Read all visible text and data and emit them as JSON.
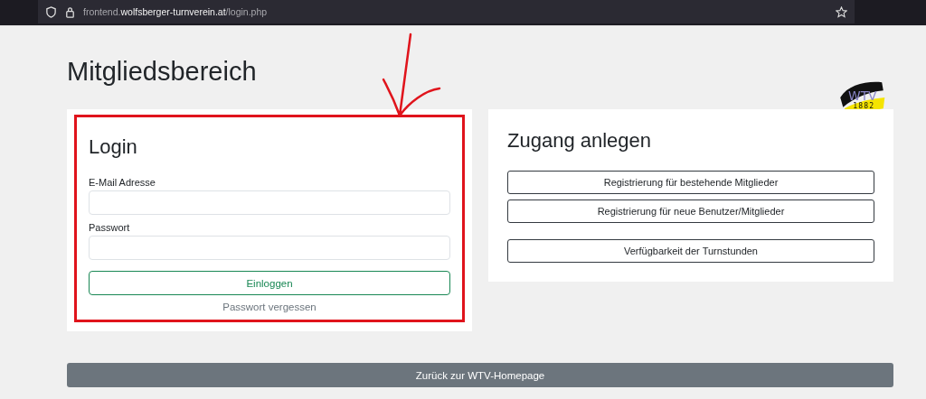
{
  "browser": {
    "url": {
      "subdomain": "frontend.",
      "domain": "wolfsberger-turnverein.at",
      "path": "/login.php"
    }
  },
  "page": {
    "title": "Mitgliedsbereich",
    "logo": {
      "letters": "WTV",
      "year": "1882"
    }
  },
  "login": {
    "title": "Login",
    "highlighted": true,
    "fields": [
      {
        "label": "E-Mail Adresse"
      },
      {
        "label": "Passwort"
      }
    ],
    "submit": "Einloggen",
    "forgot_link": "Passwort vergessen"
  },
  "register": {
    "title": "Zugang anlegen",
    "button_groups": [
      [
        "Registrierung für bestehende Mitglieder",
        "Registrierung für neue Benutzer/Mitglieder"
      ],
      [
        "Verfügbarkeit der Turnstunden"
      ]
    ]
  },
  "back_button": "Zurück zur WTV-Homepage"
}
